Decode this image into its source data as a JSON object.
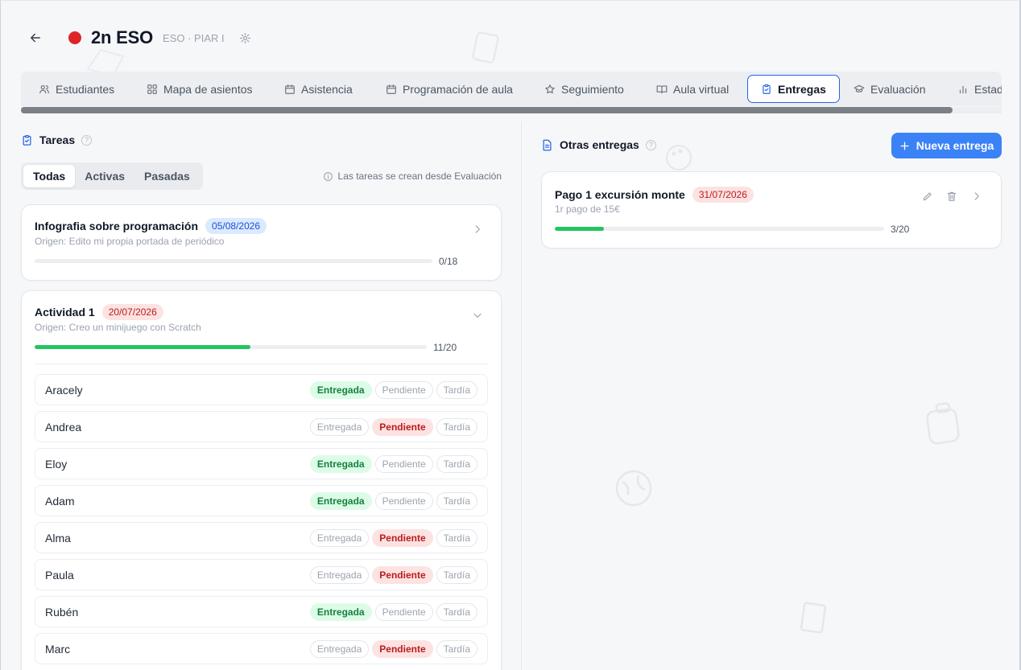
{
  "header": {
    "title": "2n ESO",
    "subtitle": "ESO · PIAR I",
    "color": "#dc2626"
  },
  "tabs": [
    {
      "label": "Estudiantes",
      "icon": "users-icon"
    },
    {
      "label": "Mapa de asientos",
      "icon": "grid-icon"
    },
    {
      "label": "Asistencia",
      "icon": "calendar-icon"
    },
    {
      "label": "Programación de aula",
      "icon": "calendar-icon"
    },
    {
      "label": "Seguimiento",
      "icon": "star-icon"
    },
    {
      "label": "Aula virtual",
      "icon": "book-open-icon"
    },
    {
      "label": "Entregas",
      "icon": "clipboard-check-icon",
      "active": true
    },
    {
      "label": "Evaluación",
      "icon": "graduation-cap-icon"
    },
    {
      "label": "Estad",
      "icon": "bar-chart-icon"
    }
  ],
  "tasks_panel": {
    "title": "Tareas",
    "filters": [
      "Todas",
      "Activas",
      "Pasadas"
    ],
    "active_filter": "Todas",
    "hint": "Las tareas se crean desde Evaluación"
  },
  "tasks": [
    {
      "title": "Infografia sobre programación",
      "date": "05/08/2026",
      "origin": "Origen: Edito mi propia portada de periódico",
      "progress_label": "0/18",
      "progress": 0
    },
    {
      "title": "Actividad 1",
      "date": "20/07/2026",
      "origin": "Origen: Creo un minijuego con Scratch",
      "progress_label": "11/20",
      "progress": 0.55
    }
  ],
  "status_labels": {
    "delivered": "Entregada",
    "pending": "Pendiente",
    "late": "Tardía"
  },
  "students": [
    {
      "name": "Aracely",
      "status": "delivered"
    },
    {
      "name": "Andrea",
      "status": "pending"
    },
    {
      "name": "Eloy",
      "status": "delivered"
    },
    {
      "name": "Adam",
      "status": "delivered"
    },
    {
      "name": "Alma",
      "status": "pending"
    },
    {
      "name": "Paula",
      "status": "pending"
    },
    {
      "name": "Rubén",
      "status": "delivered"
    },
    {
      "name": "Marc",
      "status": "pending"
    }
  ],
  "other_panel": {
    "title": "Otras entregas",
    "new_button": "Nueva entrega"
  },
  "other_deliveries": [
    {
      "title": "Pago 1 excursión monte",
      "date": "31/07/2026",
      "description": "1r pago de 15€",
      "progress_label": "3/20",
      "progress": 0.15
    }
  ]
}
